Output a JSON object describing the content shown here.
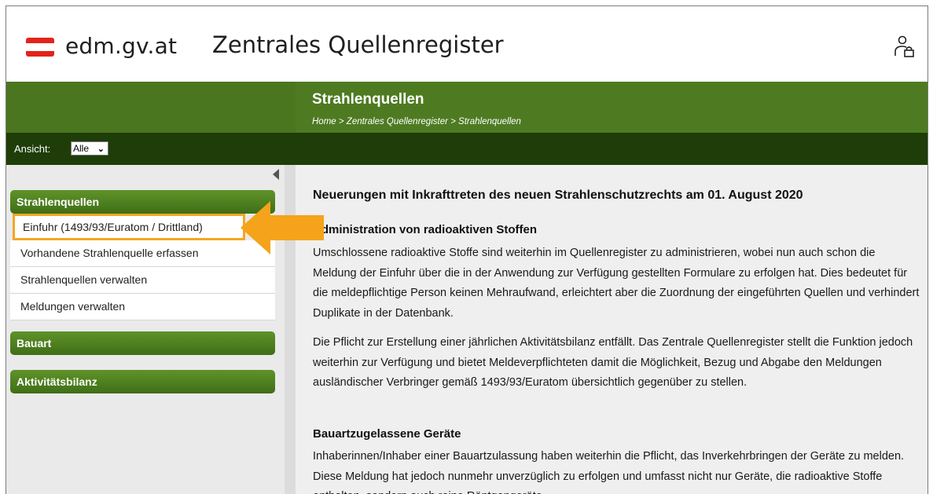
{
  "header": {
    "site_name": "edm.gv.at",
    "app_name": "Zentrales Quellenregister"
  },
  "title_band": {
    "title": "Strahlenquellen",
    "breadcrumb": [
      "Home",
      "Zentrales Quellenregister",
      "Strahlenquellen"
    ],
    "separator": " > "
  },
  "view": {
    "label": "Ansicht:",
    "selected": "Alle"
  },
  "sidebar": {
    "sections": [
      {
        "label": "Strahlenquellen",
        "items": [
          "Einfuhr (1493/93/Euratom / Drittland)",
          "Vorhandene Strahlenquelle erfassen",
          "Strahlenquellen verwalten",
          "Meldungen verwalten"
        ]
      },
      {
        "label": "Bauart",
        "items": []
      },
      {
        "label": "Aktivitätsbilanz",
        "items": []
      }
    ]
  },
  "content": {
    "heading": "Neuerungen mit Inkrafttreten des neuen Strahlenschutzrechts am 01. August 2020",
    "section1_title": "Administration von radioaktiven Stoffen",
    "section1_p1": "Umschlossene radioaktive Stoffe sind weiterhin im Quellenregister zu administrieren, wobei nun auch schon die Meldung der Einfuhr über die in der Anwendung zur Verfügung gestellten Formulare zu erfolgen hat. Dies bedeutet für die meldepflichtige Person keinen Mehraufwand, erleichtert aber die Zuordnung der eingeführten Quellen und verhindert Duplikate in der Datenbank.",
    "section1_p2": "Die Pflicht zur Erstellung einer jährlichen Aktivitätsbilanz entfällt. Das Zentrale Quellenregister stellt die Funktion jedoch weiterhin zur Verfügung und bietet Meldeverpflichteten damit die Möglichkeit, Bezug und Abgabe den Meldungen ausländischer Verbringer gemäß 1493/93/Euratom übersichtlich gegenüber zu stellen.",
    "section2_title": "Bauartzugelassene Geräte",
    "section2_p1": "Inhaberinnen/Inhaber einer Bauartzulassung haben weiterhin die Pflicht, das Inverkehrbringen der Geräte zu melden. Diese Meldung hat jedoch nunmehr unverzüglich zu erfolgen und umfasst nicht nur Geräte, die radioaktive Stoffe enthalten, sondern auch reine Röntgengeräte."
  },
  "colors": {
    "brand_red": "#e2231a",
    "green_band": "#4e7b22",
    "dark_green": "#1e3d08",
    "highlight": "#f5a623"
  }
}
